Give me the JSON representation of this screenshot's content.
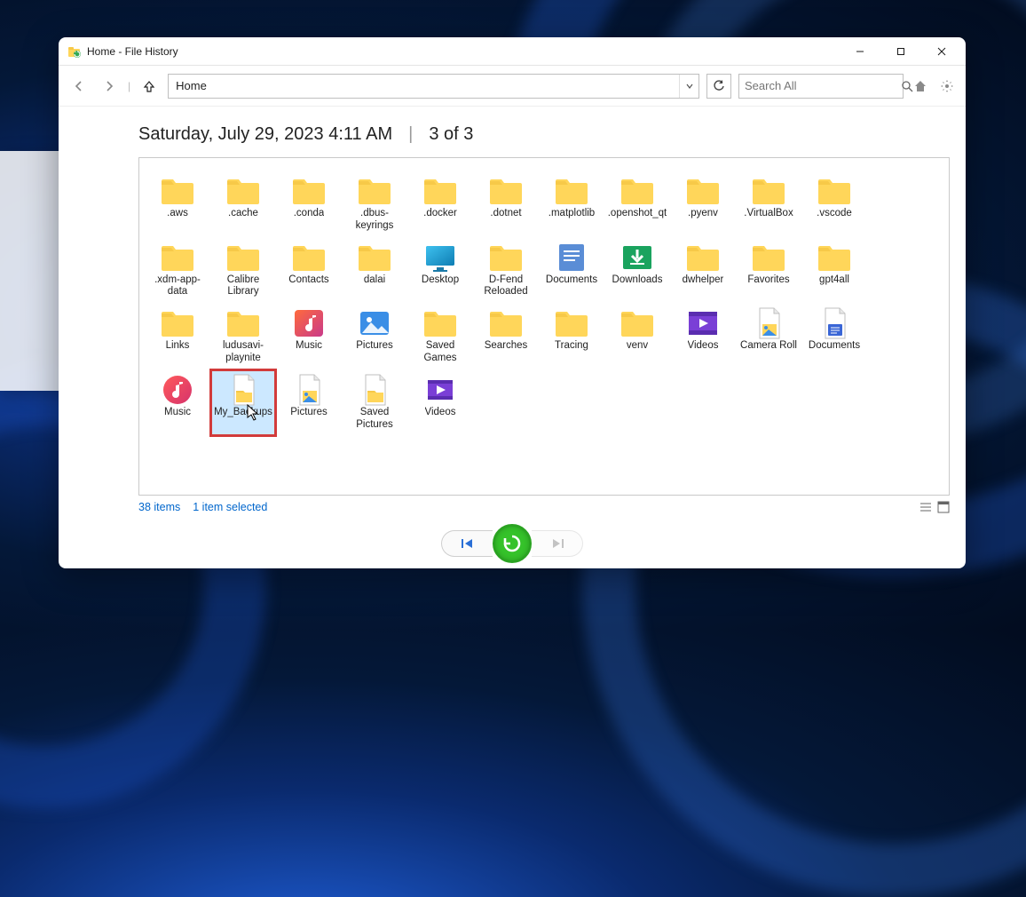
{
  "titlebar": {
    "title": "Home - File History"
  },
  "nav": {
    "location_text": "Home",
    "search_placeholder": "Search All"
  },
  "heading": {
    "timestamp": "Saturday, July 29, 2023 4:11 AM",
    "page_indicator": "3 of 3"
  },
  "status": {
    "item_count": "38 items",
    "selection": "1 item selected"
  },
  "items": [
    {
      "name": ".aws",
      "type": "folder"
    },
    {
      "name": ".cache",
      "type": "folder"
    },
    {
      "name": ".conda",
      "type": "folder"
    },
    {
      "name": ".dbus-keyrings",
      "type": "folder"
    },
    {
      "name": ".docker",
      "type": "folder"
    },
    {
      "name": ".dotnet",
      "type": "folder"
    },
    {
      "name": ".matplotlib",
      "type": "folder"
    },
    {
      "name": ".openshot_qt",
      "type": "folder"
    },
    {
      "name": ".pyenv",
      "type": "folder"
    },
    {
      "name": ".VirtualBox",
      "type": "folder"
    },
    {
      "name": ".vscode",
      "type": "folder"
    },
    {
      "name": ".xdm-app-data",
      "type": "folder"
    },
    {
      "name": "Calibre Library",
      "type": "folder"
    },
    {
      "name": "Contacts",
      "type": "folder"
    },
    {
      "name": "dalai",
      "type": "folder"
    },
    {
      "name": "Desktop",
      "type": "desktop"
    },
    {
      "name": "D-Fend Reloaded",
      "type": "folder"
    },
    {
      "name": "Documents",
      "type": "documents"
    },
    {
      "name": "Downloads",
      "type": "downloads"
    },
    {
      "name": "dwhelper",
      "type": "folder"
    },
    {
      "name": "Favorites",
      "type": "folder"
    },
    {
      "name": "gpt4all",
      "type": "folder"
    },
    {
      "name": "Links",
      "type": "folder"
    },
    {
      "name": "ludusavi-playnite",
      "type": "folder"
    },
    {
      "name": "Music",
      "type": "music"
    },
    {
      "name": "Pictures",
      "type": "pictures"
    },
    {
      "name": "Saved Games",
      "type": "folder"
    },
    {
      "name": "Searches",
      "type": "folder"
    },
    {
      "name": "Tracing",
      "type": "folder"
    },
    {
      "name": "venv",
      "type": "folder"
    },
    {
      "name": "Videos",
      "type": "videos"
    },
    {
      "name": "Camera Roll",
      "type": "file-picture"
    },
    {
      "name": "Documents",
      "type": "file-doc"
    },
    {
      "name": "Music",
      "type": "file-music"
    },
    {
      "name": "My_Backups",
      "type": "file-folder",
      "selected": true,
      "highlighted": true
    },
    {
      "name": "Pictures",
      "type": "file-picture"
    },
    {
      "name": "Saved Pictures",
      "type": "file-folder"
    },
    {
      "name": "Videos",
      "type": "file-video"
    }
  ],
  "colors": {
    "folder_body": "#ffd65a",
    "folder_tab": "#f7c948",
    "accent_blue": "#0066cc",
    "sel_bg": "#cce8ff",
    "highlight": "#d23b3b"
  }
}
